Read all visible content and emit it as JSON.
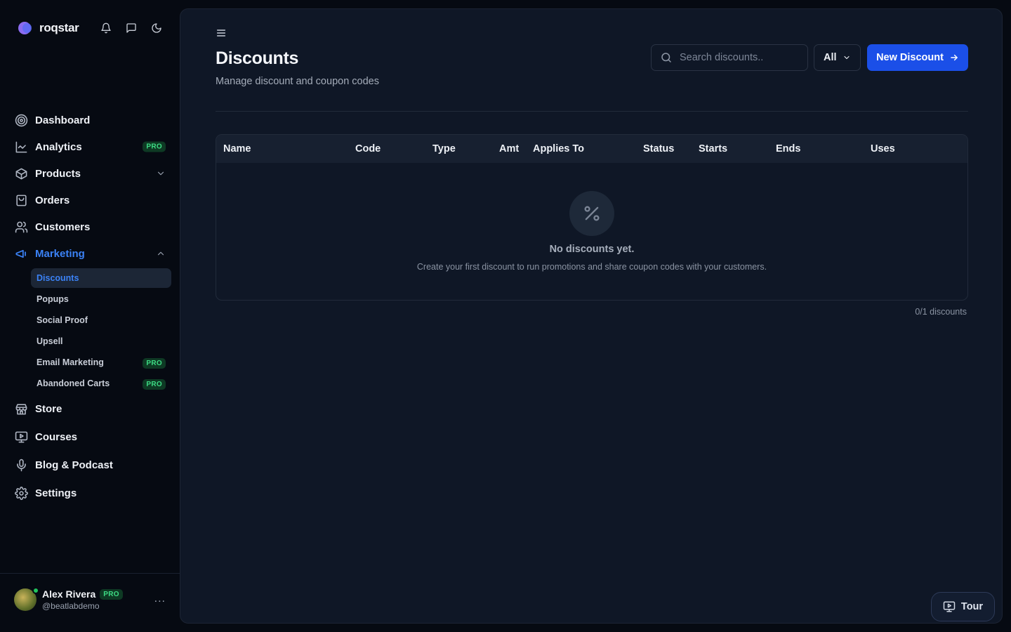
{
  "brand": {
    "name": "roqstar"
  },
  "sidebar": {
    "items_top": [
      {
        "label": "Dashboard",
        "icon": "dashboard-icon"
      },
      {
        "label": "Analytics",
        "icon": "analytics-icon",
        "badge": "PRO"
      },
      {
        "label": "Products",
        "icon": "products-icon",
        "expand": "chevron-down"
      },
      {
        "label": "Orders",
        "icon": "orders-icon"
      },
      {
        "label": "Customers",
        "icon": "customers-icon"
      },
      {
        "label": "Marketing",
        "icon": "marketing-icon",
        "expand": "chevron-up",
        "active": true
      }
    ],
    "marketing_sub": [
      {
        "label": "Discounts",
        "selected": true
      },
      {
        "label": "Popups"
      },
      {
        "label": "Social Proof"
      },
      {
        "label": "Upsell"
      },
      {
        "label": "Email Marketing",
        "badge": "PRO"
      },
      {
        "label": "Abandoned Carts",
        "badge": "PRO"
      }
    ],
    "items_bottom": [
      {
        "label": "Store",
        "icon": "store-icon"
      },
      {
        "label": "Courses",
        "icon": "courses-icon"
      },
      {
        "label": "Blog & Podcast",
        "icon": "microphone-icon"
      },
      {
        "label": "Settings",
        "icon": "settings-icon"
      }
    ],
    "user": {
      "name": "Alex Rivera",
      "badge": "PRO",
      "handle": "@beatlabdemo",
      "more": "..."
    }
  },
  "main": {
    "title": "Discounts",
    "subtitle": "Manage discount and coupon codes",
    "search": {
      "placeholder": "Search discounts.."
    },
    "filter": {
      "value": "All"
    },
    "new_button": {
      "label": "New Discount"
    },
    "table": {
      "columns": [
        "Name",
        "Code",
        "Type",
        "Amt",
        "Applies To",
        "Status",
        "Starts",
        "Ends",
        "Uses"
      ],
      "rows": [],
      "empty": {
        "title": "No discounts yet.",
        "description": "Create your first discount to run promotions and share coupon codes with your customers."
      }
    },
    "count": "0/1 discounts",
    "tour": {
      "label": "Tour"
    }
  },
  "colors": {
    "accent": "#1b4fe8",
    "active": "#3b82f6",
    "pro_badge": "#3ddc84",
    "background": "#060a12",
    "panel": "#0f1726"
  }
}
